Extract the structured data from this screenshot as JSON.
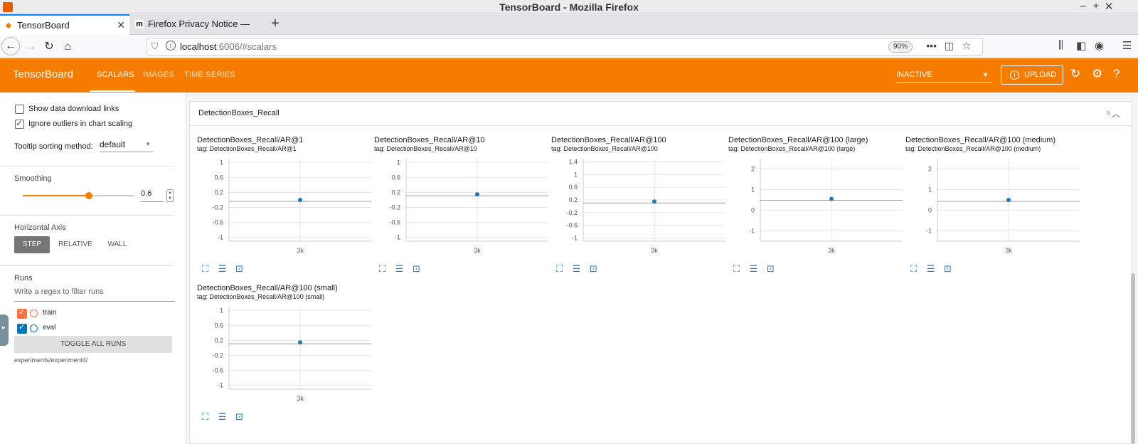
{
  "window": {
    "title": "TensorBoard - Mozilla Firefox"
  },
  "browser": {
    "tabs": [
      {
        "label": "TensorBoard",
        "active": true
      },
      {
        "label": "Firefox Privacy Notice —",
        "active": false
      }
    ],
    "url_host": "localhost",
    "url_rest": ":6006/#scalars",
    "zoom": "90%"
  },
  "toolbar": {
    "brand": "TensorBoard",
    "tabs": [
      "SCALARS",
      "IMAGES",
      "TIME SERIES"
    ],
    "run_selector": "INACTIVE",
    "upload_label": "UPLOAD"
  },
  "sidebar": {
    "show_download_links": "Show data download links",
    "ignore_outliers": "Ignore outliers in chart scaling",
    "tooltip_label": "Tooltip sorting method:",
    "tooltip_value": "default",
    "smoothing_label": "Smoothing",
    "smoothing_value": "0.6",
    "smoothing_fraction": 0.6,
    "haxis_label": "Horizontal Axis",
    "haxis_options": [
      "STEP",
      "RELATIVE",
      "WALL"
    ],
    "runs_label": "Runs",
    "runs_filter_placeholder": "Write a regex to filter runs",
    "runs": [
      {
        "name": "train",
        "color": "#ff7043",
        "checked": true
      },
      {
        "name": "eval",
        "color": "#0077bb",
        "checked": true
      }
    ],
    "toggle_all": "TOGGLE ALL RUNS",
    "path": "experiments/experiment4/"
  },
  "group": {
    "name": "DetectionBoxes_Recall",
    "count": "6"
  },
  "charts": [
    {
      "title": "DetectionBoxes_Recall/AR@1",
      "tag": "tag: DetectionBoxes_Recall/AR@1",
      "yticks": [
        "1",
        "0.6",
        "0.2",
        "-0.2",
        "-0.6",
        "-1"
      ],
      "xtick": "3k"
    },
    {
      "title": "DetectionBoxes_Recall/AR@10",
      "tag": "tag: DetectionBoxes_Recall/AR@10",
      "yticks": [
        "1",
        "0.6",
        "0.2",
        "-0.2",
        "-0.6",
        "-1"
      ],
      "xtick": "3k"
    },
    {
      "title": "DetectionBoxes_Recall/AR@100",
      "tag": "tag: DetectionBoxes_Recall/AR@100",
      "yticks": [
        "1.4",
        "1",
        "0.6",
        "0.2",
        "-0.2",
        "-0.6",
        "-1"
      ],
      "xtick": "3k"
    },
    {
      "title": "DetectionBoxes_Recall/AR@100 (large)",
      "tag": "tag: DetectionBoxes_Recall/AR@100 (large)",
      "yticks": [
        "2",
        "1",
        "0",
        "-1"
      ],
      "xtick": "3k"
    },
    {
      "title": "DetectionBoxes_Recall/AR@100 (medium)",
      "tag": "tag: DetectionBoxes_Recall/AR@100 (medium)",
      "yticks": [
        "2",
        "1",
        "0",
        "-1"
      ],
      "xtick": "3k"
    },
    {
      "title": "DetectionBoxes_Recall/AR@100 (small)",
      "tag": "tag: DetectionBoxes_Recall/AR@100 (small)",
      "yticks": [
        "1",
        "0.6",
        "0.2",
        "-0.2",
        "-0.6",
        "-1"
      ],
      "xtick": "3k"
    }
  ],
  "chart_data": [
    {
      "type": "scatter",
      "title": "DetectionBoxes_Recall/AR@1",
      "x": [
        3000
      ],
      "y": [
        0.0
      ],
      "ylim": [
        -1.1,
        1.1
      ]
    },
    {
      "type": "scatter",
      "title": "DetectionBoxes_Recall/AR@10",
      "x": [
        3000
      ],
      "y": [
        0.15
      ],
      "ylim": [
        -1.1,
        1.1
      ]
    },
    {
      "type": "scatter",
      "title": "DetectionBoxes_Recall/AR@100",
      "x": [
        3000
      ],
      "y": [
        0.15
      ],
      "ylim": [
        -1.1,
        1.5
      ]
    },
    {
      "type": "scatter",
      "title": "DetectionBoxes_Recall/AR@100 (large)",
      "x": [
        3000
      ],
      "y": [
        0.55
      ],
      "ylim": [
        -1.5,
        2.5
      ]
    },
    {
      "type": "scatter",
      "title": "DetectionBoxes_Recall/AR@100 (medium)",
      "x": [
        3000
      ],
      "y": [
        0.5
      ],
      "ylim": [
        -1.5,
        2.5
      ]
    },
    {
      "type": "scatter",
      "title": "DetectionBoxes_Recall/AR@100 (small)",
      "x": [
        3000
      ],
      "y": [
        0.15
      ],
      "ylim": [
        -1.1,
        1.1
      ]
    }
  ],
  "colors": {
    "accent": "#f57c00",
    "series": "#1f77b4"
  },
  "icons": [
    "fullscreen-icon",
    "toggle-log-scale-icon",
    "fit-domain-icon"
  ]
}
